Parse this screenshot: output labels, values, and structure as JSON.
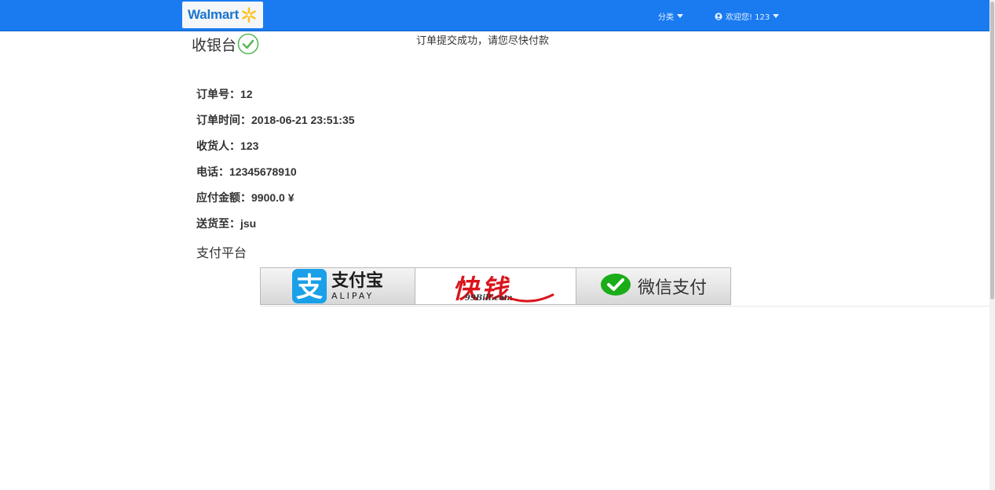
{
  "navbar": {
    "brand": "Walmart",
    "category_label": "分类",
    "user_label": "欢迎您! 123"
  },
  "page": {
    "title": "收银台",
    "success_message": "订单提交成功，请您尽快付款"
  },
  "order": [
    {
      "label": "订单号：",
      "value": "12"
    },
    {
      "label": "订单时间：",
      "value": "2018-06-21 23:51:35"
    },
    {
      "label": "收货人：",
      "value": "123"
    },
    {
      "label": "电话：",
      "value": "12345678910"
    },
    {
      "label": "应付金额：",
      "value": "9900.0 ¥"
    },
    {
      "label": "送货至：",
      "value": "jsu"
    }
  ],
  "payment": {
    "section_title": "支付平台",
    "options": [
      {
        "name": "支付宝",
        "sub": "ALIPAY",
        "icon": "alipay-icon",
        "color": "#1aa0e8"
      },
      {
        "name": "快钱",
        "sub": "99Bill.com",
        "icon": "99bill-logo",
        "color": "#d9141c"
      },
      {
        "name": "微信支付",
        "icon": "wechat-pay-icon",
        "color": "#1aad19"
      }
    ]
  },
  "colors": {
    "nav_bg": "#1a7bf1",
    "brand_blue": "#1a75cf",
    "brand_yellow": "#ffc220",
    "check_green": "#5cb85c"
  }
}
